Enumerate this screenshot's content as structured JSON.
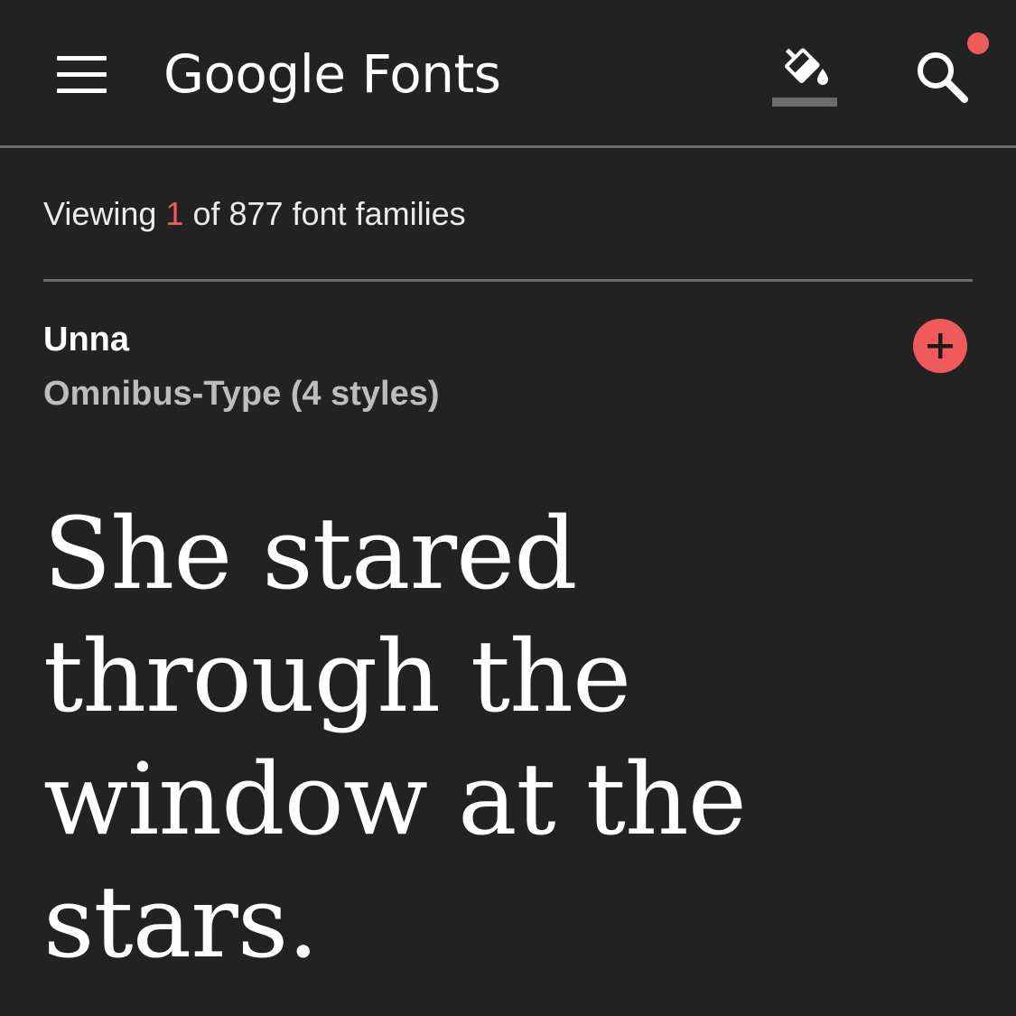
{
  "appbar": {
    "brand": "Google Fonts",
    "icons": {
      "menu": "hamburger-menu-icon",
      "theme": "paint-bucket-icon",
      "search": "search-icon"
    },
    "notification_dot": true
  },
  "results": {
    "prefix": "Viewing ",
    "shown": "1",
    "suffix": " of 877 font families"
  },
  "font_card": {
    "name": "Unna",
    "meta": "Omnibus-Type (4 styles)",
    "add_icon": "plus-icon",
    "sample_text": "She stared through the window at the stars."
  },
  "colors": {
    "background": "#222222",
    "accent": "#f05a5a",
    "divider": "#6a6a6a",
    "text_primary": "#ffffff",
    "text_secondary": "#bdbdbd"
  }
}
